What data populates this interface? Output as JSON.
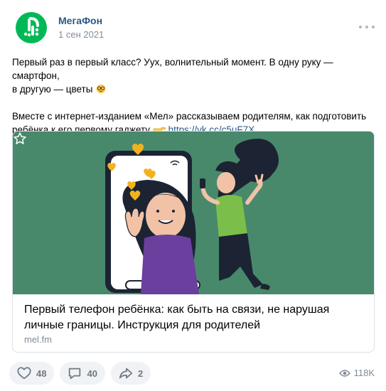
{
  "post": {
    "author": "МегаФон",
    "date": "1 сен 2021",
    "avatar_icon": "megafon-logo-icon",
    "more_icon": "more-horizontal-icon",
    "text_line_1": "Первый раз в первый класс? Ууx, волнительный момент. В одну руку — смартфон,",
    "text_line_2": "в другую — цветы",
    "emoji_1": "nerd-face-emoji-icon",
    "text_line_3": "Вместе с интернет-изданием «Мел» рассказываем родителям, как подготовить",
    "text_line_4": "ребёнка к его первому гаджету",
    "emoji_2": "pointing-hand-emoji-icon",
    "link": "https://vk.cc/c5uF7X"
  },
  "card": {
    "image_icon": "illustration-phone-girl-boy",
    "bookmark_icon": "star-icon",
    "title": "Первый телефон ребёнка: как быть на связи, не нарушая личные границы. Инструкция для родителей",
    "domain": "mel.fm"
  },
  "actions": {
    "likes": {
      "icon": "heart-icon",
      "count": "48"
    },
    "comments": {
      "icon": "comment-icon",
      "count": "40"
    },
    "shares": {
      "icon": "share-icon",
      "count": "2"
    },
    "views": {
      "icon": "eye-icon",
      "count": "118K"
    }
  },
  "colors": {
    "brand_green": "#00b956",
    "link": "#2a5885",
    "image_bg": "#49896b"
  }
}
